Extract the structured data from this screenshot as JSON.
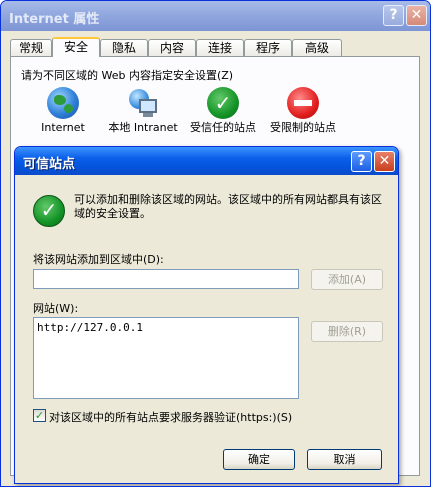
{
  "main_window": {
    "title": "Internet 属性",
    "help_glyph": "?",
    "close_glyph": "✕",
    "tabs": [
      {
        "label": "常规"
      },
      {
        "label": "安全"
      },
      {
        "label": "隐私"
      },
      {
        "label": "内容"
      },
      {
        "label": "连接"
      },
      {
        "label": "程序"
      },
      {
        "label": "高级"
      }
    ],
    "active_tab": "安全",
    "zone_prompt": "请为不同区域的 Web 内容指定安全设置(Z)",
    "zones": [
      {
        "label": "Internet",
        "icon": "globe-icon"
      },
      {
        "label": "本地 Intranet",
        "icon": "intranet-icon"
      },
      {
        "label": "受信任的站点",
        "icon": "trusted-check-icon"
      },
      {
        "label": "受限制的站点",
        "icon": "restricted-icon"
      }
    ]
  },
  "dialog": {
    "title": "可信站点",
    "help_glyph": "?",
    "close_glyph": "✕",
    "check_glyph": "✓",
    "info_text": "可以添加和删除该区域的网站。该区域中的所有网站都具有该区域的安全设置。",
    "add_label": "将该网站添加到区域中(D):",
    "add_input_value": "",
    "add_button": "添加(A)",
    "sites_label": "网站(W):",
    "sites": [
      "http://127.0.0.1"
    ],
    "remove_button": "删除(R)",
    "require_https_label": "对该区域中的所有站点要求服务器验证(https:)(S)",
    "require_https_checked": true,
    "checkmark": "✓",
    "ok_button": "确定",
    "cancel_button": "取消"
  }
}
